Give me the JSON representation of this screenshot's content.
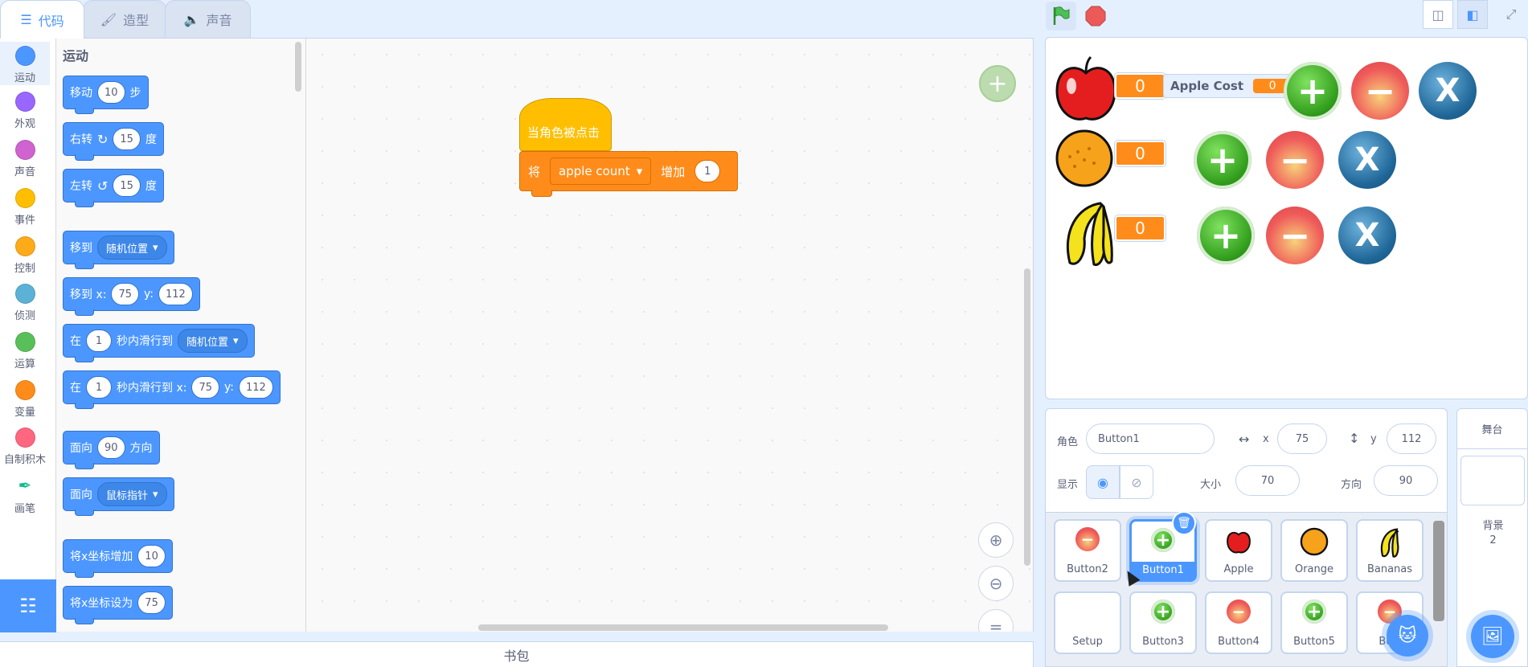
{
  "tabs": [
    {
      "label": "代码",
      "icon": "code-icon"
    },
    {
      "label": "造型",
      "icon": "brush-icon"
    },
    {
      "label": "声音",
      "icon": "speaker-icon"
    }
  ],
  "categories": [
    {
      "label": "运动",
      "color": "#4c97ff"
    },
    {
      "label": "外观",
      "color": "#9966ff"
    },
    {
      "label": "声音",
      "color": "#cf63cf"
    },
    {
      "label": "事件",
      "color": "#ffbf00"
    },
    {
      "label": "控制",
      "color": "#ffab19"
    },
    {
      "label": "侦测",
      "color": "#5cb1d6"
    },
    {
      "label": "运算",
      "color": "#59c059"
    },
    {
      "label": "变量",
      "color": "#ff8c1a"
    },
    {
      "label": "自制积木",
      "color": "#ff6680"
    },
    {
      "label": "画笔",
      "icon": "pen-icon"
    }
  ],
  "palette": {
    "title": "运动",
    "blocks": {
      "move": {
        "pre": "移动",
        "v": "10",
        "post": "步"
      },
      "turn_right": {
        "pre": "右转",
        "v": "15",
        "post": "度"
      },
      "turn_left": {
        "pre": "左转",
        "v": "15",
        "post": "度"
      },
      "goto": {
        "pre": "移到",
        "drop": "随机位置"
      },
      "goto_xy": {
        "pre": "移到 x:",
        "x": "75",
        "ymid": "y:",
        "y": "112"
      },
      "glide": {
        "pre": "在",
        "v": "1",
        "mid": "秒内滑行到",
        "drop": "随机位置"
      },
      "glide_xy": {
        "pre": "在",
        "v": "1",
        "mid": "秒内滑行到 x:",
        "x": "75",
        "ymid": "y:",
        "y": "112"
      },
      "point": {
        "pre": "面向",
        "v": "90",
        "post": "方向"
      },
      "point_towards": {
        "pre": "面向",
        "drop": "鼠标指针"
      },
      "change_x": {
        "pre": "将x坐标增加",
        "v": "10"
      },
      "set_x": {
        "pre": "将x坐标设为",
        "v": "75"
      }
    }
  },
  "script": {
    "hat": "当角色被点击",
    "set_pre": "将",
    "set_var": "apple count",
    "set_mid": "增加",
    "set_val": "1"
  },
  "backpack": "书包",
  "stage": {
    "apple_count": "0",
    "orange_count": "0",
    "banana_count": "0",
    "apple_cost_label": "Apple Cost",
    "apple_cost_value": "0",
    "plus": "+",
    "minus": "−",
    "clear": "X"
  },
  "sprite_info": {
    "sprite_label": "角色",
    "sprite_name": "Button1",
    "x_label": "x",
    "x": "75",
    "y_label": "y",
    "y": "112",
    "show_label": "显示",
    "size_label": "大小",
    "size": "70",
    "direction_label": "方向",
    "direction": "90"
  },
  "sprites": [
    {
      "name": "Button2",
      "thumb": "minus"
    },
    {
      "name": "Button1",
      "thumb": "plus",
      "selected": true
    },
    {
      "name": "Apple",
      "thumb": "apple"
    },
    {
      "name": "Orange",
      "thumb": "orange"
    },
    {
      "name": "Bananas",
      "thumb": "banana"
    },
    {
      "name": "Setup",
      "thumb": "none"
    },
    {
      "name": "Button3",
      "thumb": "plus"
    },
    {
      "name": "Button4",
      "thumb": "minus"
    },
    {
      "name": "Button5",
      "thumb": "plus"
    },
    {
      "name": "Butt",
      "thumb": "minus"
    }
  ],
  "stage_panel": {
    "title": "舞台",
    "backdrop_label": "背景",
    "backdrop_count": "2"
  },
  "colors": {
    "motion": "#4c97ff",
    "events": "#ffbf00",
    "variables": "#ff8c1a",
    "green_button": "#2f9b1a",
    "red_button": "#ef5a5a",
    "blue_button": "#1f6798"
  }
}
